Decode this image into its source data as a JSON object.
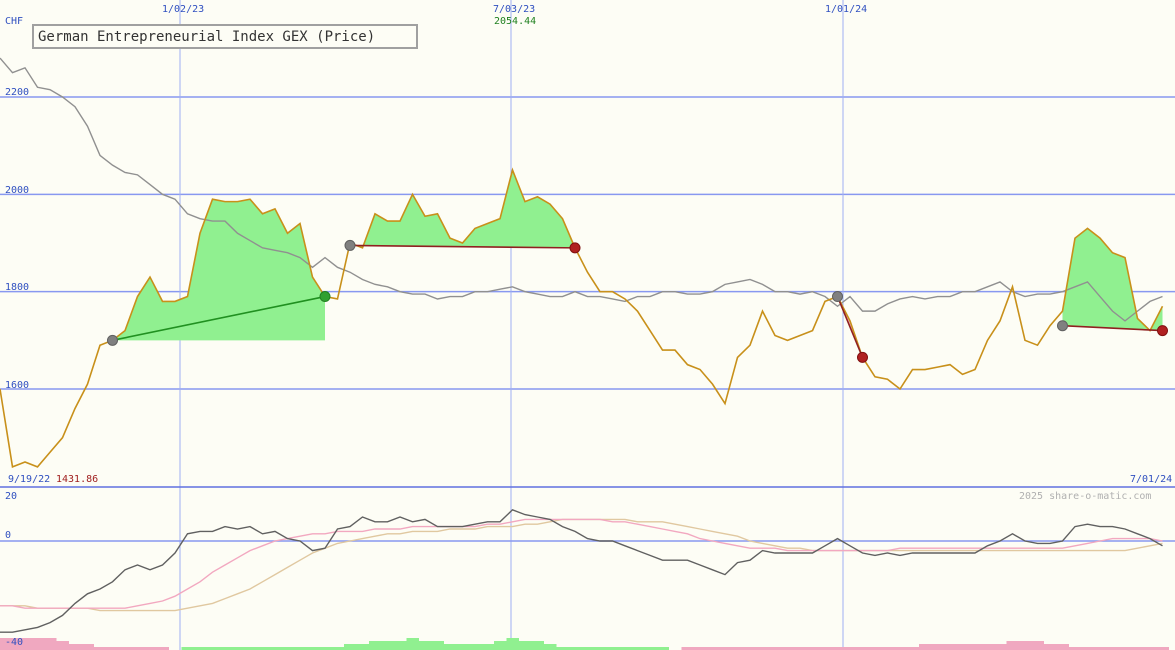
{
  "chart_data": {
    "type": "line",
    "title": "German Entrepreneurial Index GEX (Price)",
    "currency": "CHF",
    "credit": "2025 share-o-matic.com",
    "price_panel": {
      "ylim": [
        1400,
        2400
      ],
      "yticks": [
        1600,
        1800,
        2000,
        2200
      ],
      "x_date_labels": [
        "9/19/22",
        "1/02/23",
        "7/03/23",
        "1/01/24",
        "7/01/24"
      ],
      "low_annotation": {
        "date": "9/19/22",
        "value": "1431.86"
      },
      "high_annotation": {
        "date": "7/03/23",
        "value": "2054.44"
      },
      "series": [
        {
          "name": "price",
          "color": "#c8901a",
          "values": [
            1600,
            1440,
            1450,
            1440,
            1470,
            1500,
            1560,
            1610,
            1690,
            1700,
            1720,
            1790,
            1830,
            1780,
            1780,
            1790,
            1920,
            1990,
            1985,
            1985,
            1990,
            1960,
            1970,
            1920,
            1940,
            1830,
            1790,
            1785,
            1900,
            1890,
            1960,
            1945,
            1945,
            2000,
            1955,
            1960,
            1910,
            1900,
            1930,
            1940,
            1950,
            2050,
            1985,
            1995,
            1980,
            1950,
            1890,
            1840,
            1800,
            1800,
            1785,
            1760,
            1720,
            1680,
            1680,
            1650,
            1640,
            1610,
            1570,
            1665,
            1690,
            1760,
            1710,
            1700,
            1710,
            1720,
            1780,
            1790,
            1740,
            1665,
            1625,
            1620,
            1600,
            1640,
            1640,
            1645,
            1650,
            1630,
            1640,
            1700,
            1740,
            1810,
            1700,
            1690,
            1730,
            1760,
            1910,
            1930,
            1910,
            1880,
            1870,
            1745,
            1720,
            1770
          ]
        },
        {
          "name": "moving average",
          "color": "#909090",
          "values": [
            2280,
            2250,
            2260,
            2220,
            2215,
            2200,
            2180,
            2140,
            2080,
            2060,
            2045,
            2040,
            2020,
            2000,
            1990,
            1960,
            1950,
            1945,
            1945,
            1920,
            1905,
            1890,
            1885,
            1880,
            1870,
            1850,
            1870,
            1850,
            1840,
            1825,
            1815,
            1810,
            1800,
            1795,
            1795,
            1785,
            1790,
            1790,
            1800,
            1800,
            1805,
            1810,
            1800,
            1795,
            1790,
            1790,
            1800,
            1790,
            1790,
            1785,
            1780,
            1790,
            1790,
            1800,
            1800,
            1795,
            1795,
            1800,
            1815,
            1820,
            1825,
            1815,
            1800,
            1800,
            1795,
            1800,
            1790,
            1770,
            1790,
            1760,
            1760,
            1775,
            1785,
            1790,
            1785,
            1790,
            1790,
            1800,
            1800,
            1810,
            1820,
            1800,
            1790,
            1795,
            1795,
            1800,
            1810,
            1820,
            1790,
            1760,
            1740,
            1760,
            1780,
            1790
          ]
        }
      ],
      "signals": [
        {
          "type": "buy",
          "start_index": 9,
          "end_index": 26,
          "start_value": 1700,
          "end_value": 1790
        },
        {
          "type": "sell",
          "start_index": 28,
          "end_index": 46,
          "start_value": 1895,
          "end_value": 1890
        },
        {
          "type": "sell",
          "start_index": 67,
          "end_index": 69,
          "start_value": 1790,
          "end_value": 1665
        },
        {
          "type": "sell",
          "start_index": 85,
          "end_index": 93,
          "start_value": 1730,
          "end_value": 1720
        }
      ]
    },
    "indicator_panel": {
      "ylim": [
        -40,
        20
      ],
      "yticks": [
        20,
        0,
        -40
      ],
      "series": [
        {
          "name": "oscillator",
          "color": "#606060",
          "values": [
            -38,
            -38,
            -37,
            -36,
            -34,
            -31,
            -26,
            -22,
            -20,
            -17,
            -12,
            -10,
            -12,
            -10,
            -5,
            3,
            4,
            4,
            6,
            5,
            6,
            3,
            4,
            1,
            0,
            -4,
            -3,
            5,
            6,
            10,
            8,
            8,
            10,
            8,
            9,
            6,
            6,
            6,
            7,
            8,
            8,
            13,
            11,
            10,
            9,
            6,
            4,
            1,
            0,
            0,
            -2,
            -4,
            -6,
            -8,
            -8,
            -8,
            -10,
            -12,
            -14,
            -9,
            -8,
            -4,
            -5,
            -5,
            -5,
            -5,
            -2,
            1,
            -2,
            -5,
            -6,
            -5,
            -6,
            -5,
            -5,
            -5,
            -5,
            -5,
            -5,
            -2,
            0,
            3,
            0,
            -1,
            -1,
            0,
            6,
            7,
            6,
            6,
            5,
            3,
            1,
            -2
          ]
        },
        {
          "name": "signal line",
          "color": "#f2a8c0",
          "values": [
            -27,
            -27,
            -28,
            -28,
            -28,
            -28,
            -28,
            -28,
            -28,
            -28,
            -28,
            -27,
            -26,
            -25,
            -23,
            -20,
            -17,
            -13,
            -10,
            -7,
            -4,
            -2,
            0,
            1,
            2,
            3,
            3,
            4,
            4,
            4,
            5,
            5,
            5,
            6,
            6,
            6,
            6,
            6,
            6,
            7,
            7,
            8,
            9,
            9,
            9,
            9,
            9,
            9,
            9,
            8,
            8,
            7,
            6,
            5,
            4,
            3,
            1,
            0,
            -1,
            -2,
            -3,
            -3,
            -3,
            -4,
            -4,
            -4,
            -4,
            -4,
            -4,
            -4,
            -4,
            -4,
            -3,
            -3,
            -3,
            -3,
            -3,
            -3,
            -3,
            -3,
            -3,
            -3,
            -3,
            -3,
            -3,
            -3,
            -2,
            -1,
            0,
            1,
            1,
            1,
            1,
            0
          ]
        },
        {
          "name": "slow line",
          "color": "#e0c8a0",
          "values": [
            -27,
            -27,
            -27,
            -28,
            -28,
            -28,
            -28,
            -28,
            -29,
            -29,
            -29,
            -29,
            -29,
            -29,
            -29,
            -28,
            -27,
            -26,
            -24,
            -22,
            -20,
            -17,
            -14,
            -11,
            -8,
            -5,
            -3,
            -1,
            0,
            1,
            2,
            3,
            3,
            4,
            4,
            4,
            5,
            5,
            5,
            6,
            6,
            6,
            7,
            7,
            8,
            9,
            9,
            9,
            9,
            9,
            9,
            8,
            8,
            8,
            7,
            6,
            5,
            4,
            3,
            2,
            0,
            -1,
            -2,
            -3,
            -3,
            -4,
            -4,
            -4,
            -4,
            -4,
            -4,
            -4,
            -4,
            -4,
            -4,
            -4,
            -4,
            -4,
            -4,
            -4,
            -4,
            -4,
            -4,
            -4,
            -4,
            -4,
            -4,
            -4,
            -4,
            -4,
            -4,
            -3,
            -2,
            -1
          ]
        }
      ],
      "histogram": {
        "pos_color": "#90f090",
        "neg_color": "#f0a8c0",
        "values": [
          -4,
          -4,
          -4,
          -4,
          -4,
          -3,
          -2,
          -2,
          -1,
          -1,
          -1,
          -1,
          -1,
          -1,
          0,
          1,
          1,
          1,
          1,
          1,
          1,
          1,
          1,
          1,
          1,
          1,
          1,
          1,
          2,
          2,
          3,
          3,
          3,
          4,
          3,
          3,
          2,
          2,
          2,
          2,
          3,
          4,
          3,
          3,
          2,
          1,
          1,
          1,
          1,
          1,
          1,
          1,
          1,
          1,
          0,
          -1,
          -1,
          -1,
          -1,
          -1,
          -1,
          -1,
          -1,
          -1,
          -1,
          -1,
          -1,
          -1,
          -1,
          -1,
          -1,
          -1,
          -1,
          -1,
          -2,
          -2,
          -2,
          -2,
          -2,
          -2,
          -2,
          -3,
          -3,
          -3,
          -2,
          -2,
          -1,
          -1,
          -1,
          -1,
          -1,
          -1,
          -1,
          -1
        ]
      }
    }
  }
}
